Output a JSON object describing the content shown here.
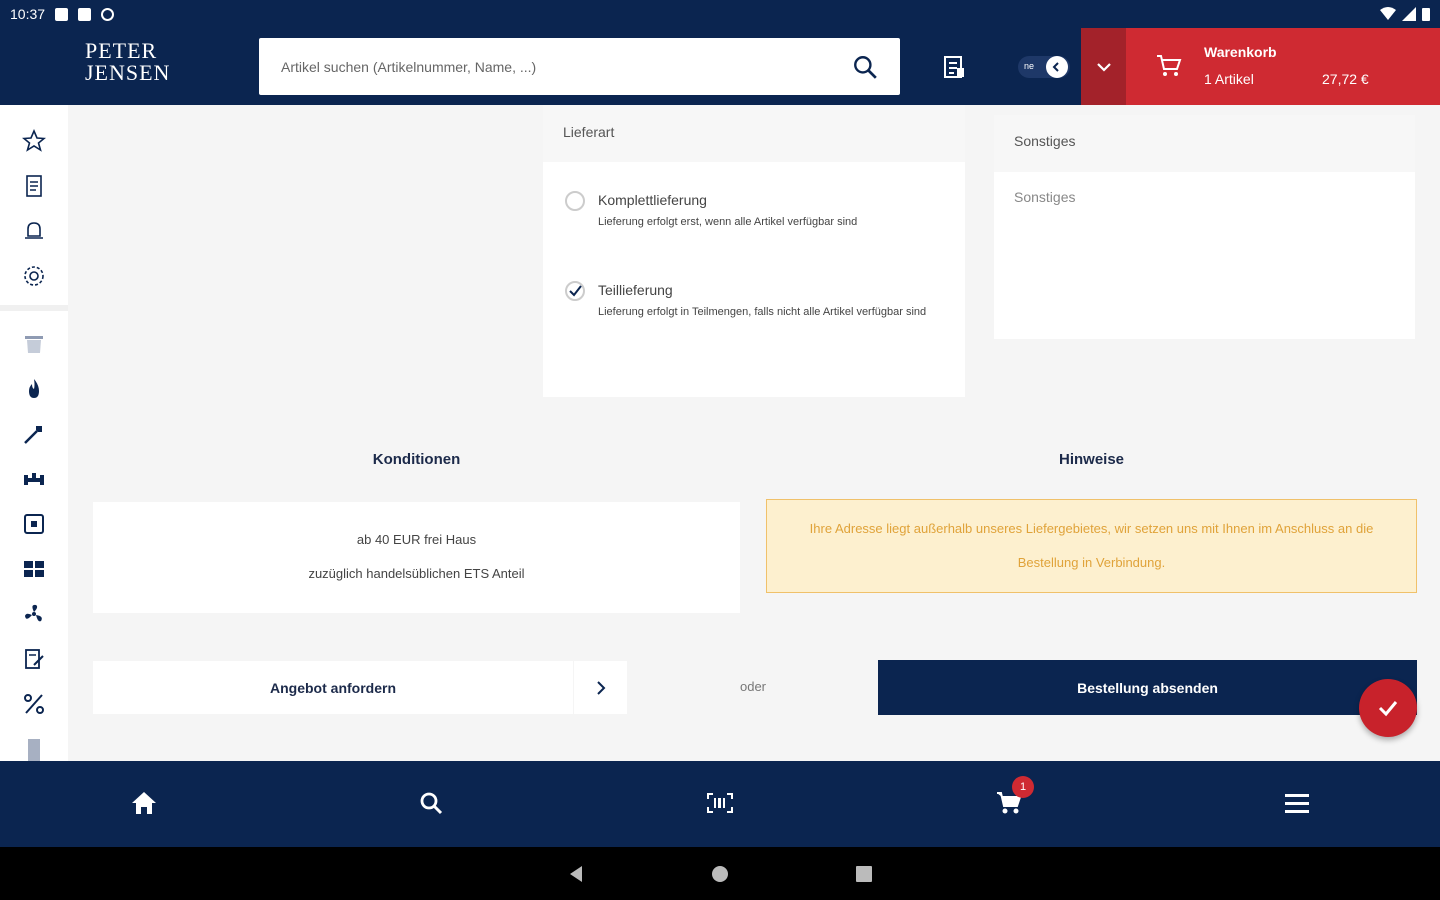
{
  "status_bar": {
    "time": "10:37"
  },
  "header": {
    "logo_line1": "PETER",
    "logo_line2": "JENSEN",
    "search_placeholder": "Artikel suchen (Artikelnummer, Name, ...)",
    "toggle_label": "ne",
    "cart": {
      "title": "Warenkorb",
      "count": "1 Artikel",
      "price": "27,72 €"
    }
  },
  "delivery": {
    "header": "Lieferart",
    "options": [
      {
        "title": "Komplettlieferung",
        "desc": "Lieferung erfolgt erst, wenn alle Artikel verfügbar sind",
        "selected": false
      },
      {
        "title": "Teillieferung",
        "desc": "Lieferung erfolgt in Teilmengen, falls nicht alle Artikel verfügbar sind",
        "selected": true
      }
    ]
  },
  "misc": {
    "header": "Sonstiges",
    "placeholder": "Sonstiges"
  },
  "conditions": {
    "title": "Konditionen",
    "line1": "ab 40 EUR frei Haus",
    "line2": "zuzüglich handelsüblichen ETS Anteil"
  },
  "hints": {
    "title": "Hinweise",
    "text": "Ihre Adresse liegt außerhalb unseres Liefergebietes, wir setzen uns mit Ihnen im Anschluss an die Bestellung in Verbindung."
  },
  "actions": {
    "offer": "Angebot anfordern",
    "or": "oder",
    "order": "Bestellung absenden"
  },
  "bottom_nav": {
    "cart_badge": "1"
  },
  "colors": {
    "navy": "#0b2550",
    "red": "#cf2a32",
    "warning_bg": "#fdf0cf",
    "warning_text": "#e0a33a"
  }
}
